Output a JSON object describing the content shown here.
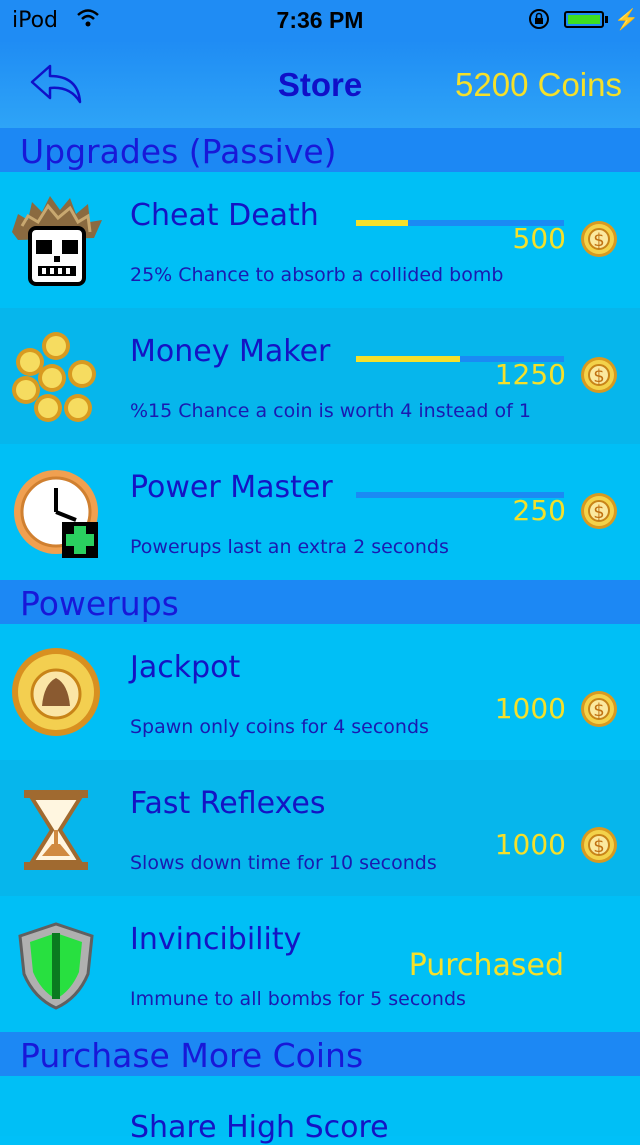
{
  "status": {
    "carrier": "iPod",
    "time": "7:36 PM",
    "battery_fraction": 1.0
  },
  "nav": {
    "title": "Store",
    "coins": "5200 Coins"
  },
  "sections": {
    "upgrades": "Upgrades (Passive)",
    "powerups": "Powerups",
    "purchase": "Purchase More Coins"
  },
  "upgrades": [
    {
      "icon": "skull-character-icon",
      "name": "Cheat Death",
      "price": "500",
      "level_fraction": 0.25,
      "desc": "25% Chance to absorb a collided bomb"
    },
    {
      "icon": "coin-pile-icon",
      "name": "Money Maker",
      "price": "1250",
      "level_fraction": 0.5,
      "desc": "%15 Chance a coin is worth 4 instead of 1"
    },
    {
      "icon": "clock-plus-icon",
      "name": "Power Master",
      "price": "250",
      "level_fraction": 0.0,
      "desc": "Powerups last an extra 2 seconds"
    }
  ],
  "powerups": [
    {
      "icon": "jackpot-coin-icon",
      "name": "Jackpot",
      "price": "1000",
      "desc": "Spawn only coins for 4 seconds"
    },
    {
      "icon": "hourglass-icon",
      "name": "Fast Reflexes",
      "price": "1000",
      "desc": "Slows down time for 10 seconds"
    },
    {
      "icon": "shield-icon",
      "name": "Invincibility",
      "status": "Purchased",
      "desc": "Immune to all bombs for 5 seconds"
    }
  ],
  "purchase_items": [
    {
      "name": "Share High Score"
    }
  ],
  "colors": {
    "accent": "#1f8cf4",
    "row_bg": "#00bff6",
    "text_blue": "#1414c4",
    "coin_yellow": "#f5e02a"
  }
}
